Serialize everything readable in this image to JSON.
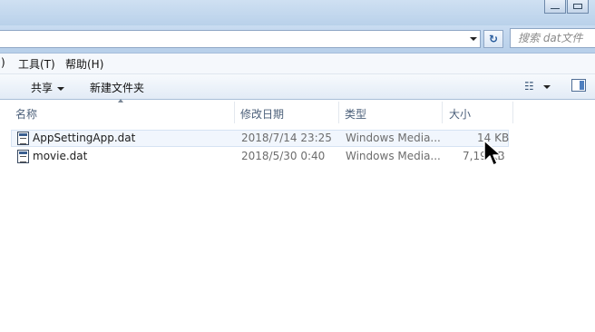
{
  "search": {
    "placeholder": "搜索 dat文件"
  },
  "address": {
    "refresh_glyph": "↻"
  },
  "menu": {
    "partial_left": ")",
    "items": [
      "工具(T)",
      "帮助(H)"
    ]
  },
  "commands": {
    "share_label": "共享",
    "new_folder_label": "新建文件夹"
  },
  "columns": {
    "name": "名称",
    "modified": "修改日期",
    "type": "类型",
    "size": "大小"
  },
  "files": [
    {
      "name": "AppSettingApp.dat",
      "modified": "2018/7/14 23:25",
      "type": "Windows Media...",
      "size": "14 KB",
      "selected": true
    },
    {
      "name": "movie.dat",
      "modified": "2018/5/30 0:40",
      "type": "Windows Media...",
      "size": "7,19 KB",
      "selected": false
    }
  ],
  "icons": {
    "refresh": "refresh-icon",
    "view": "view-options-icon",
    "preview_pane": "preview-pane-icon",
    "file": "dat-file-icon",
    "cursor": "mouse-pointer-icon"
  },
  "colors": {
    "chrome_blue": "#b9d1ea",
    "selection": "#f1f6fd",
    "header_text": "#4c607a"
  }
}
